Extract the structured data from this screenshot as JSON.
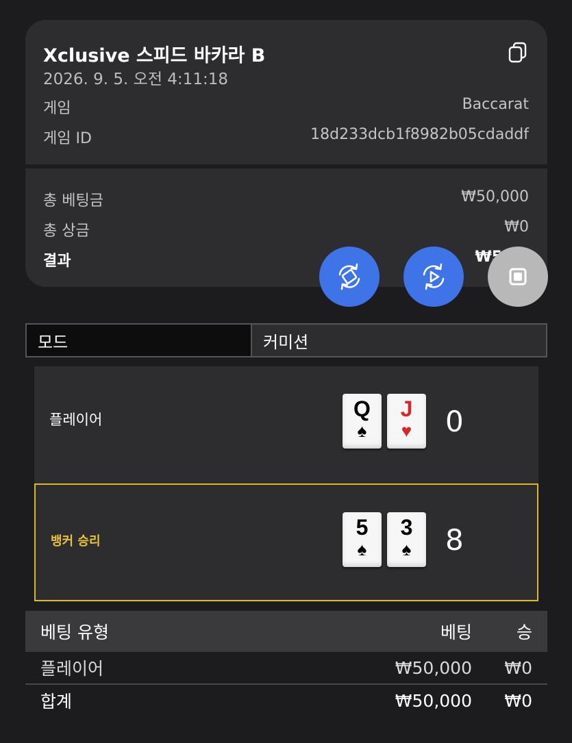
{
  "summary": {
    "title": "Xclusive 스피드 바카라 B",
    "datetime": "2026. 9. 5. 오전 4:11:18",
    "game_label": "게임",
    "game_value": "Baccarat",
    "game_id_label": "게임 ID",
    "game_id_value": "18d233dcb1f8982b05cdaddf",
    "total_bet_label": "총 베팅금",
    "total_bet_value": "₩50,000",
    "total_win_label": "총 상금",
    "total_win_value": "₩0",
    "result_label": "결과",
    "result_value": "₩50,0"
  },
  "icons": {
    "copy": "copy-icon",
    "rotate": "rotate-screen-icon",
    "replay": "replay-icon",
    "stop": "stop-icon"
  },
  "mode_bar": {
    "mode_label": "모드",
    "commission_label": "커미션"
  },
  "hands": {
    "player": {
      "label": "플레이어",
      "cards": [
        {
          "rank": "Q",
          "suit": "♠",
          "color": "#000000"
        },
        {
          "rank": "J",
          "suit": "♥",
          "color": "#d7262a"
        }
      ],
      "score": "0"
    },
    "banker": {
      "label": "뱅커 승리",
      "cards": [
        {
          "rank": "5",
          "suit": "♠",
          "color": "#000000"
        },
        {
          "rank": "3",
          "suit": "♠",
          "color": "#000000"
        }
      ],
      "score": "8"
    }
  },
  "bet_table": {
    "headers": {
      "type": "베팅 유형",
      "bet": "베팅",
      "win": "승"
    },
    "rows": [
      {
        "type": "플레이어",
        "bet": "₩50,000",
        "win": "₩0"
      }
    ],
    "total": {
      "type": "합계",
      "bet": "₩50,000",
      "win": "₩0"
    }
  },
  "colors": {
    "background": "#1c1c1e",
    "card": "#2d2d2f",
    "accent_blue": "#3f73e8",
    "banker_gold": "#e8c33a"
  }
}
